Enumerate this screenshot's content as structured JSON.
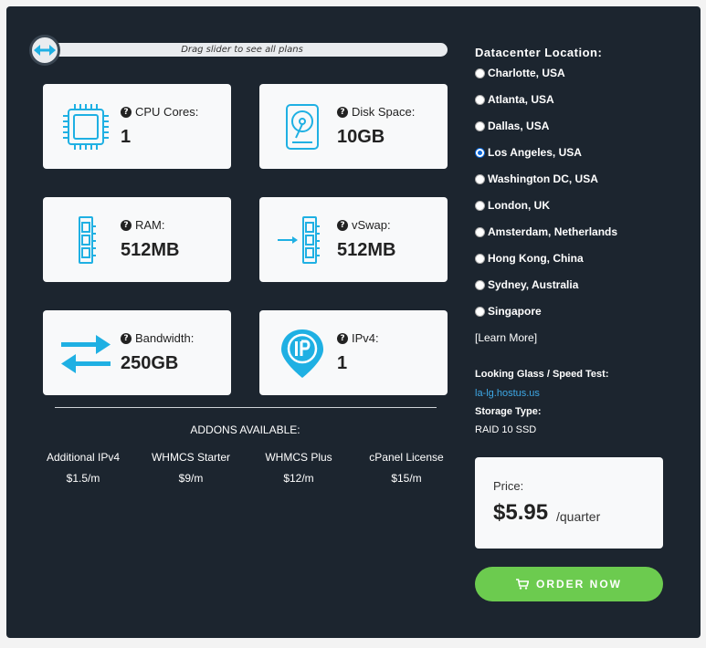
{
  "slider": {
    "hint": "Drag slider to see all plans"
  },
  "specs": [
    {
      "label": "CPU Cores:",
      "value": "1",
      "icon": "cpu-icon"
    },
    {
      "label": "Disk Space:",
      "value": "10GB",
      "icon": "hard-disk-icon"
    },
    {
      "label": "RAM:",
      "value": "512MB",
      "icon": "ram-icon"
    },
    {
      "label": "vSwap:",
      "value": "512MB",
      "icon": "vswap-icon"
    },
    {
      "label": "Bandwidth:",
      "value": "250GB",
      "icon": "bandwidth-arrows-icon"
    },
    {
      "label": "IPv4:",
      "value": "1",
      "icon": "ip-pin-icon"
    }
  ],
  "addons": {
    "title": "ADDONS AVAILABLE:",
    "items": [
      {
        "name": "Additional IPv4",
        "price": "$1.5/m"
      },
      {
        "name": "WHMCS Starter",
        "price": "$9/m"
      },
      {
        "name": "WHMCS Plus",
        "price": "$12/m"
      },
      {
        "name": "cPanel License",
        "price": "$15/m"
      }
    ]
  },
  "datacenter": {
    "title": "Datacenter Location:",
    "selected": "Los Angeles, USA",
    "options": [
      "Charlotte, USA",
      "Atlanta, USA",
      "Dallas, USA",
      "Los Angeles, USA",
      "Washington DC, USA",
      "London, UK",
      "Amsterdam, Netherlands",
      "Hong Kong, China",
      "Sydney, Australia",
      "Singapore"
    ],
    "learn_more": "[Learn More]"
  },
  "info": {
    "looking_glass_label": "Looking Glass / Speed Test:",
    "looking_glass_link": "la-lg.hostus.us",
    "storage_label": "Storage Type:",
    "storage_value": "RAID 10 SSD"
  },
  "price": {
    "label": "Price:",
    "amount": "$5.95",
    "period": "/quarter"
  },
  "order": {
    "label": "ORDER NOW"
  },
  "colors": {
    "panel_bg": "#1c252f",
    "card_bg": "#f8f9fa",
    "icon_blue": "#1fb0e3",
    "order_green": "#6ccb4f",
    "link_blue": "#3ea8e6"
  }
}
